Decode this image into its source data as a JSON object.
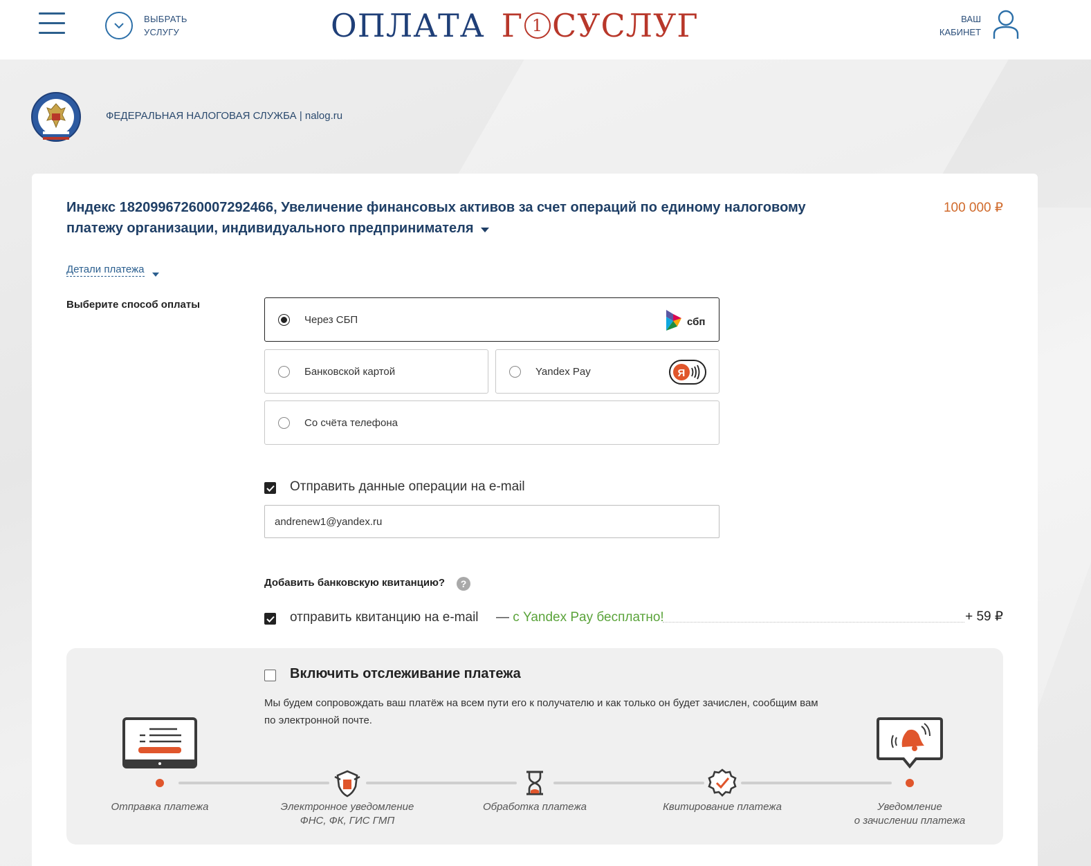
{
  "header": {
    "choose_service_line1": "ВЫБРАТЬ",
    "choose_service_line2": "УСЛУГУ",
    "logo_left": "ОПЛАТА",
    "logo_right_first": "Г",
    "logo_one": "1",
    "logo_right_rest": "СУСЛУГ",
    "cabinet_line1": "ВАШ",
    "cabinet_line2": "КАБИНЕТ"
  },
  "org": {
    "name": "ФЕДЕРАЛЬНАЯ НАЛОГОВАЯ СЛУЖБА | nalog.ru"
  },
  "payment": {
    "title": "Индекс 18209967260007292466, Увеличение финансовых активов за счет операций по единому налоговому платежу организации, индивидуального предпринимателя",
    "amount": "100 000 ₽",
    "details_link": "Детали платежа"
  },
  "methods": {
    "label": "Выберите способ оплаты",
    "items": [
      {
        "label": "Через СБП",
        "selected": true,
        "logo": "sbp-logo",
        "logo_text": "сбп"
      },
      {
        "label": "Банковской картой",
        "selected": false
      },
      {
        "label": "Yandex Pay",
        "selected": false,
        "logo": "yandex-pay-logo",
        "logo_text": "Я"
      },
      {
        "label": "Со счёта телефона",
        "selected": false
      }
    ]
  },
  "email": {
    "checkbox_label": "Отправить данные операции на e-mail",
    "checked": true,
    "value": "andrenew1@yandex.ru"
  },
  "receipt": {
    "title": "Добавить банковскую квитанцию?",
    "help": "?",
    "checkbox_label": "отправить квитанцию на e-mail",
    "checked": true,
    "promo_dash": "—",
    "promo": "с Yandex Pay бесплатно!",
    "fee": "+ 59 ₽"
  },
  "tracking": {
    "checked": false,
    "title": "Включить отслеживание платежа",
    "description": "Мы будем сопровождать ваш платёж на всем пути его к получателю и как только он будет зачислен, сообщим вам по электронной почте.",
    "steps": [
      {
        "label1": "Отправка платежа",
        "label2": "",
        "icon": "laptop-icon"
      },
      {
        "label1": "Электронное уведомление",
        "label2": "ФНС, ФК, ГИС ГМП",
        "icon": "shield-icon"
      },
      {
        "label1": "Обработка платежа",
        "label2": "",
        "icon": "hourglass-icon"
      },
      {
        "label1": "Квитирование платежа",
        "label2": "",
        "icon": "badge-check-icon"
      },
      {
        "label1": "Уведомление",
        "label2": "о зачислении платежа",
        "icon": "bell-icon"
      }
    ]
  },
  "colors": {
    "brand_blue": "#1f3f78",
    "brand_red": "#b8372a",
    "amount_orange": "#d06a2b",
    "promo_green": "#5aa33a",
    "step_dot": "#e0562c"
  }
}
